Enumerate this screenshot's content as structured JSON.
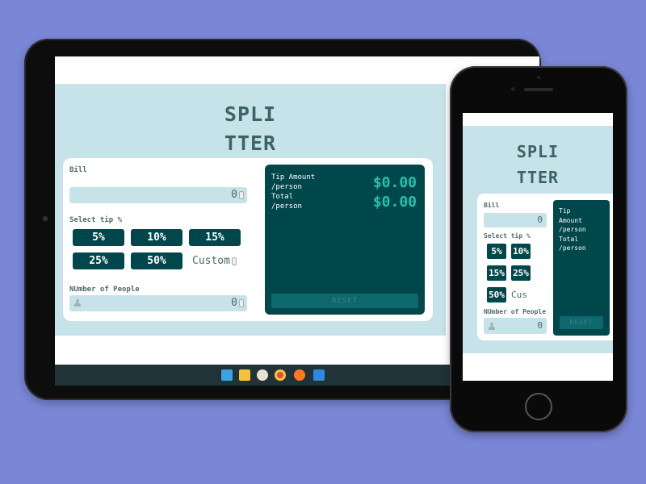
{
  "app": {
    "title_line1": "SPLI",
    "title_line2": "TTER"
  },
  "bill": {
    "label": "Bill",
    "value": "0"
  },
  "tip": {
    "label": "Select tip %",
    "options": [
      "5%",
      "10%",
      "15%",
      "25%",
      "50%"
    ],
    "custom_label": "Custom",
    "custom_label_mobile": "Cus"
  },
  "people": {
    "label": "NUmber of People",
    "value": "0"
  },
  "results": {
    "tip_label_line1": "Tip Amount",
    "tip_label_line2": "/person",
    "tip_value": "$0.00",
    "total_label_line1": "Total",
    "total_label_line2": "/person",
    "total_value": "$0.00",
    "mobile_tip_line1": "Tip",
    "mobile_tip_line2": "Amount",
    "reset_label": "RESET"
  },
  "taskbar": {
    "icons": [
      "windows-start-icon",
      "file-explorer-icon",
      "app-icon",
      "chrome-icon",
      "firefox-icon",
      "vscode-icon"
    ]
  },
  "colors": {
    "background": "#7a86d6",
    "app_bg": "#c5e3e8",
    "dark_teal": "#00474b",
    "accent": "#26c2ad",
    "reset_bg": "#0d686d"
  }
}
